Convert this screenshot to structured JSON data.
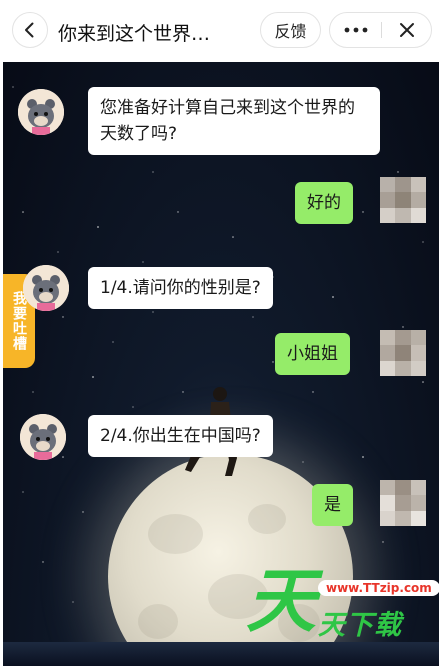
{
  "header": {
    "title": "你来到这个世界…",
    "feedback_label": "反馈"
  },
  "side_tab": {
    "label": "我要吐槽"
  },
  "messages": [
    {
      "from": "bot",
      "text": "您准备好计算自己来到这个世界的天数了吗?"
    },
    {
      "from": "me",
      "text": "好的"
    },
    {
      "from": "bot",
      "text": "1/4.请问你的性别是?"
    },
    {
      "from": "me",
      "text": "小姐姐"
    },
    {
      "from": "bot",
      "text": "2/4.你出生在中国吗?"
    },
    {
      "from": "me",
      "text": "是"
    }
  ],
  "watermark": {
    "url": "www.TTzip.com",
    "big": "天",
    "text": "天下载"
  },
  "colors": {
    "my_bubble": "#95ec69",
    "bot_bubble": "#ffffff",
    "side_tab": "#f7b528",
    "watermark_green": "#2fc646",
    "watermark_red": "#e8352a"
  },
  "icons": [
    "chevron-left-icon",
    "more-dots-icon",
    "close-icon",
    "bot-avatar-icon",
    "user-avatar-icon"
  ]
}
